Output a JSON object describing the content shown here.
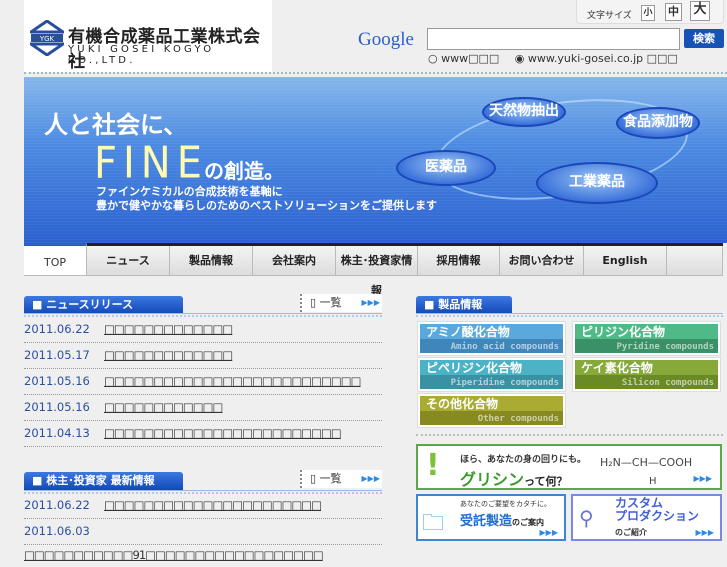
{
  "logo": {
    "company_jp": "有機合成薬品工業株式会社",
    "company_en": "YUKI GOSEI KOGYO CO.,LTD.",
    "mark": "YGK"
  },
  "font_size": {
    "label": "文字サイズ",
    "small": "小",
    "medium": "中",
    "large": "大"
  },
  "search": {
    "brand": "Google",
    "value": "",
    "button": "検索",
    "scope_www": "www□□□",
    "scope_site": "www.yuki-gosei.co.jp □□□",
    "selected": "site"
  },
  "banner": {
    "headline": "人と社会に、",
    "fine": "FINE",
    "fine_suffix": "の創造。",
    "sub1": "ファインケミカルの合成技術を基軸に",
    "sub2": "豊かで健やかな暮らしのためのベストソリューションをご提供します",
    "bubbles": [
      "天然物抽出",
      "食品添加物",
      "医薬品",
      "工業薬品"
    ]
  },
  "nav": [
    {
      "label": "TOP",
      "active": true
    },
    {
      "label": "ニュース"
    },
    {
      "label": "製品情報"
    },
    {
      "label": "会社案内"
    },
    {
      "label": "株主･投資家情報"
    },
    {
      "label": "採用情報"
    },
    {
      "label": "お問い合わせ"
    },
    {
      "label": "English"
    },
    {
      "label": ""
    }
  ],
  "news": {
    "title": "ニュースリリース",
    "list_label": "一覧",
    "items": [
      {
        "date": "2011.06.22",
        "title": "□□□□□□□□□□□□□"
      },
      {
        "date": "2011.05.17",
        "title": "□□□□□□□□□□□□□"
      },
      {
        "date": "2011.05.16",
        "title": "□□□□□□□□□□□□□□□□□□□□□□□□□□"
      },
      {
        "date": "2011.05.16",
        "title": "□□□□□□□□□□□□"
      },
      {
        "date": "2011.04.13",
        "title": "□□□□□□□□□□□□□□□□□□□□□□□□"
      }
    ]
  },
  "investor": {
    "title": "株主･投資家 最新情報",
    "list_label": "一覧",
    "items": [
      {
        "date": "2011.06.22",
        "title": "□□□□□□□□□□□□□□□□□□□□□□"
      },
      {
        "date": "2011.06.03",
        "title": "□□□□□□□□□□□91□□□□□□□□□□□□□□□□□□"
      }
    ]
  },
  "products": {
    "title": "製品情報",
    "items": [
      {
        "jp": "アミノ酸化合物",
        "en": "Amino acid compounds",
        "color": "#5ba9dc",
        "dark": "#3f86bb"
      },
      {
        "jp": "ピリジン化合物",
        "en": "Pyridine compounds",
        "color": "#4fb987",
        "dark": "#3a9168"
      },
      {
        "jp": "ピペリジン化合物",
        "en": "Piperidine compounds",
        "color": "#4cb3c6",
        "dark": "#3a91a4"
      },
      {
        "jp": "ケイ素化合物",
        "en": "Silicon compounds",
        "color": "#86a93a",
        "dark": "#6a8a26"
      },
      {
        "jp": "その他化合物",
        "en": "Other compounds",
        "color": "#a9ab33",
        "dark": "#878921"
      }
    ]
  },
  "promos": {
    "glycine_top": "ほら、あなたの身の回りにも。",
    "glycine_main": "グリシン",
    "glycine_suffix": "って何？",
    "formula": "H₂N—CH—COOH",
    "formula_h": "H",
    "contract_top": "あなたのご要望をカタチに。",
    "contract_main": "受託製造",
    "contract_suffix": "のご案内",
    "custom_main1": "カスタム",
    "custom_main2": "プロダクション",
    "custom_suffix": "のご紹介"
  }
}
